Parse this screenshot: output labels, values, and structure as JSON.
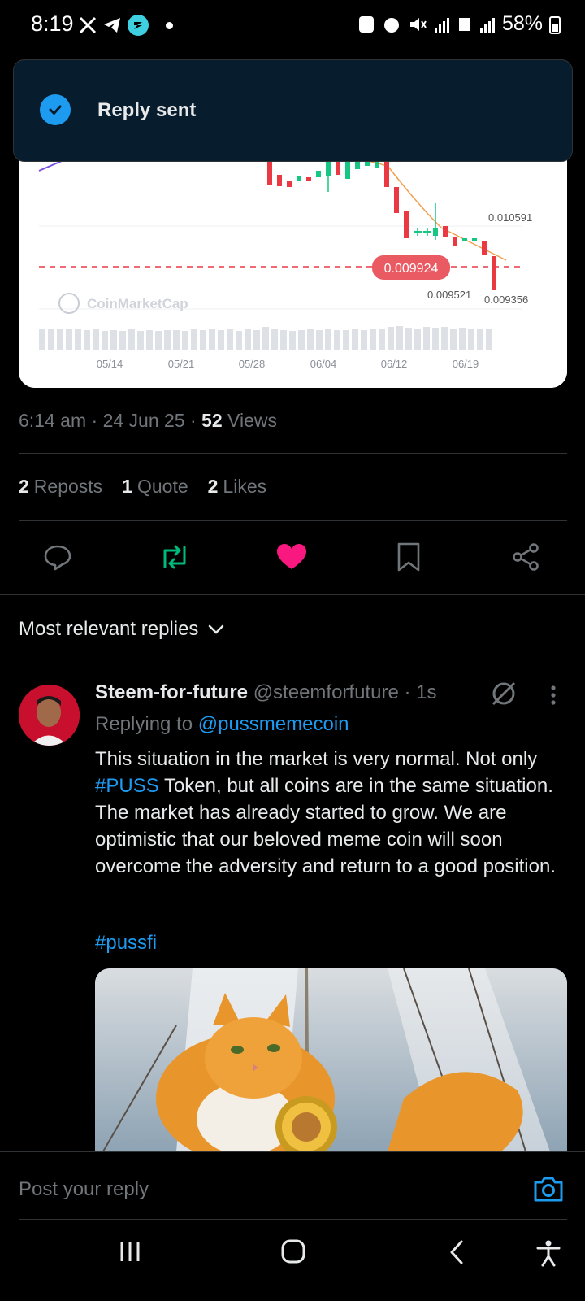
{
  "status_bar": {
    "time": "8:19",
    "battery": "58%"
  },
  "toast": {
    "text": "Reply sent"
  },
  "chart": {
    "watermark": "CoinMarketCap",
    "price_labels": [
      "0.010591",
      "0.009924",
      "0.009521",
      "0.009356"
    ],
    "dates": [
      "05/14",
      "05/21",
      "05/28",
      "06/04",
      "06/12",
      "06/19"
    ]
  },
  "post_meta": {
    "time": "6:14 am",
    "date": "24 Jun 25",
    "views_count": "52",
    "views_label": "Views"
  },
  "counts": {
    "reposts": "2",
    "reposts_label": "Reposts",
    "quotes": "1",
    "quotes_label": "Quote",
    "likes": "2",
    "likes_label": "Likes"
  },
  "sort": {
    "label": "Most relevant replies"
  },
  "reply": {
    "name": "Steem-for-future",
    "handle": "@steemforfuture",
    "time": "1s",
    "replying_prefix": "Replying to",
    "replying_to": "@pussmemecoin",
    "body_part1": "This situation in the market is very normal. Not only ",
    "body_hashtag": "#PUSS",
    "body_part2": " Token, but all coins are in the same situation. The market has already started to grow. We are optimistic that our beloved meme coin will soon overcome the adversity and return to a good position.",
    "hashtag": "#pussfi"
  },
  "composer": {
    "placeholder": "Post your reply"
  },
  "colors": {
    "accent": "#1d9bf0",
    "like": "#f91880",
    "repost": "#00ba7c"
  }
}
